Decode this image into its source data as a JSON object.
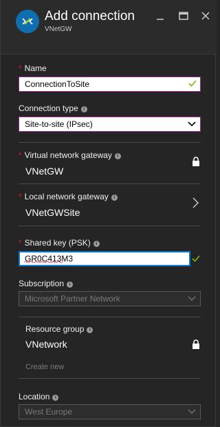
{
  "header": {
    "title": "Add connection",
    "subtitle": "VNetGW"
  },
  "fields": {
    "name": {
      "label": "Name",
      "value": "ConnectionToSite"
    },
    "connection_type": {
      "label": "Connection type",
      "value": "Site-to-site (IPsec)"
    },
    "virtual_network_gateway": {
      "label": "Virtual network gateway",
      "value": "VNetGW"
    },
    "local_network_gateway": {
      "label": "Local network gateway",
      "value": "VNetGWSite"
    },
    "shared_key": {
      "label": "Shared key (PSK)",
      "value": "GR0C413M3"
    },
    "subscription": {
      "label": "Subscription",
      "value": "Microsoft Partner Network"
    },
    "resource_group": {
      "label": "Resource group",
      "value": "VNetwork",
      "create_new": "Create new"
    },
    "location": {
      "label": "Location",
      "value": "West Europe"
    }
  },
  "colors": {
    "background": "#252525",
    "required": "#e81123",
    "valid_check": "#7fba00",
    "focus_border": "#0a7ad6",
    "input_border": "#9a2f9a"
  },
  "icons": [
    "connection-logo-icon",
    "minimize-icon",
    "maximize-icon",
    "close-icon",
    "info-icon",
    "check-icon",
    "chevron-down-icon",
    "lock-icon",
    "chevron-right-icon"
  ]
}
